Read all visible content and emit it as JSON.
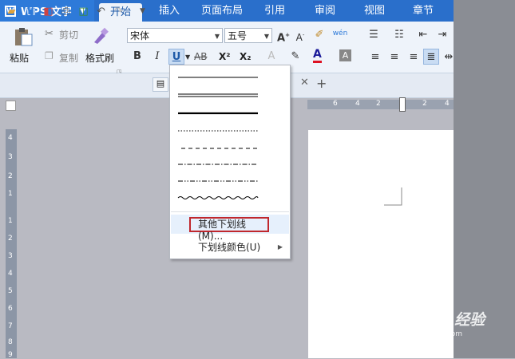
{
  "app": {
    "title": "WPS 文字",
    "logo": "W"
  },
  "tabs": [
    "开始",
    "插入",
    "页面布局",
    "引用",
    "审阅",
    "视图",
    "章节"
  ],
  "ribbon": {
    "paste": "粘贴",
    "cut": "剪切",
    "copy": "复制",
    "format_painter": "格式刷",
    "font_name": "宋体",
    "font_size": "五号",
    "bold": "B",
    "italic": "I",
    "underline": "U",
    "strike": "AB",
    "superscript": "X²",
    "subscript": "X₂",
    "font_color": "A"
  },
  "underline_menu": {
    "styles": [
      "single",
      "double",
      "thick",
      "dotted",
      "dash",
      "dash-dot",
      "dash-dot-dot",
      "wave"
    ],
    "more_underlines": "其他下划线(M)...",
    "underline_color": "下划线颜色(U)"
  },
  "rulers": {
    "horizontal": [
      "6",
      "4",
      "2",
      "2",
      "4"
    ],
    "vertical": [
      "4",
      "3",
      "2",
      "1",
      "1",
      "2",
      "3",
      "4",
      "5",
      "6",
      "7",
      "8",
      "9"
    ]
  },
  "watermark": {
    "main": "Bai du 经验",
    "sub": "jingyan.baidu.com"
  },
  "colors": {
    "tab_bar": "#2a6fcb",
    "highlight_border": "#c0272d",
    "accent": "#2e7ad9"
  }
}
